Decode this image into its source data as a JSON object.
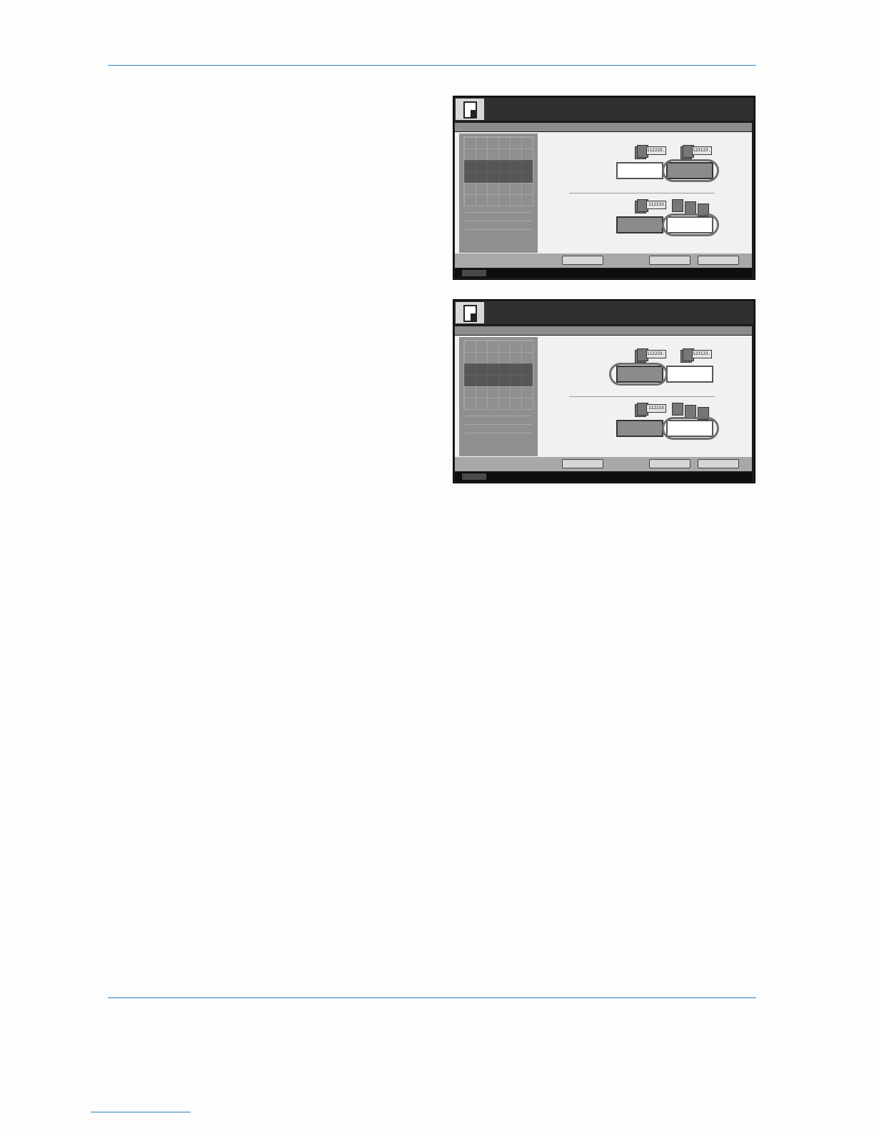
{
  "screens": [
    {
      "icons": {
        "collate_off": "112233...",
        "collate_on": "123123...",
        "offset_off": "112233",
        "offset_on": "stacked-sheets"
      },
      "collate_selected": "right",
      "offset_selected": "right"
    },
    {
      "icons": {
        "collate_off": "112233...",
        "collate_on": "123123...",
        "offset_off": "112233",
        "offset_on": "stacked-sheets"
      },
      "collate_selected": "left",
      "offset_selected": "right"
    }
  ],
  "colors": {
    "rule": "#2a7fc0",
    "selected": "#8b8b8b",
    "frame": "#1b1b1b"
  }
}
